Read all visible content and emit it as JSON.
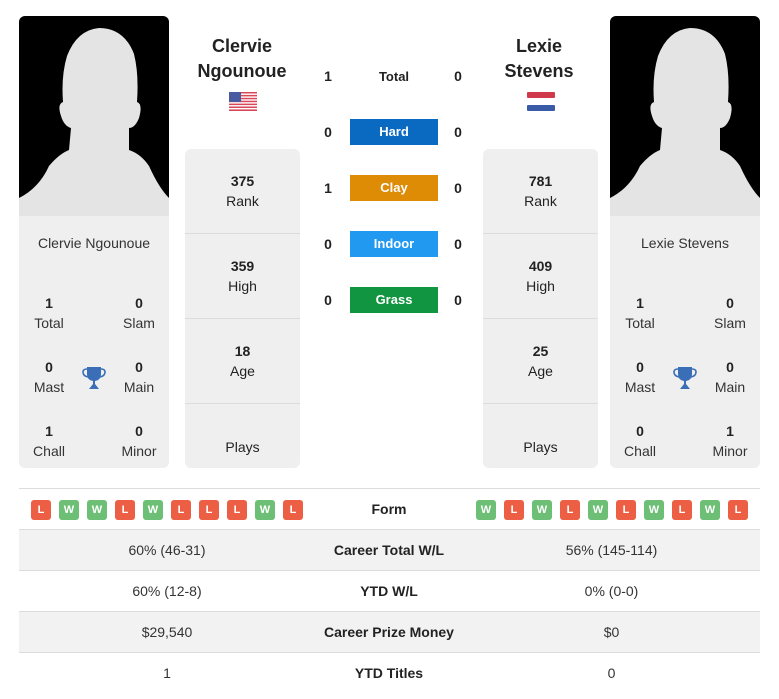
{
  "player_left": {
    "name_line1": "Clervie",
    "name_line2": "Ngounoue",
    "full_name": "Clervie Ngounoue",
    "flag": "us-flag-icon",
    "rank": "375",
    "rank_label": "Rank",
    "high": "359",
    "high_label": "High",
    "age": "18",
    "age_label": "Age",
    "plays_label": "Plays",
    "titles": {
      "total": "1",
      "total_label": "Total",
      "slam": "0",
      "slam_label": "Slam",
      "mast": "0",
      "mast_label": "Mast",
      "main": "0",
      "main_label": "Main",
      "chall": "1",
      "chall_label": "Chall",
      "minor": "0",
      "minor_label": "Minor"
    },
    "form": [
      "L",
      "W",
      "W",
      "L",
      "W",
      "L",
      "L",
      "L",
      "W",
      "L"
    ]
  },
  "player_right": {
    "name_line1": "Lexie",
    "name_line2": "Stevens",
    "full_name": "Lexie Stevens",
    "flag": "netherlands-flag-icon",
    "rank": "781",
    "rank_label": "Rank",
    "high": "409",
    "high_label": "High",
    "age": "25",
    "age_label": "Age",
    "plays_label": "Plays",
    "titles": {
      "total": "1",
      "total_label": "Total",
      "slam": "0",
      "slam_label": "Slam",
      "mast": "0",
      "mast_label": "Mast",
      "main": "0",
      "main_label": "Main",
      "chall": "0",
      "chall_label": "Chall",
      "minor": "1",
      "minor_label": "Minor"
    },
    "form": [
      "W",
      "L",
      "W",
      "L",
      "W",
      "L",
      "W",
      "L",
      "W",
      "L"
    ]
  },
  "h2h": {
    "total": {
      "label": "Total",
      "left": "1",
      "right": "0"
    },
    "surfaces": [
      {
        "label": "Hard",
        "left": "0",
        "right": "0",
        "color": "#0a6ac2"
      },
      {
        "label": "Clay",
        "left": "1",
        "right": "0",
        "color": "#de8b06"
      },
      {
        "label": "Indoor",
        "left": "0",
        "right": "0",
        "color": "#2299f1"
      },
      {
        "label": "Grass",
        "left": "0",
        "right": "0",
        "color": "#119540"
      }
    ]
  },
  "comparison": {
    "form_label": "Form",
    "rows": [
      {
        "label": "Career Total W/L",
        "left": "60% (46-31)",
        "right": "56% (145-114)"
      },
      {
        "label": "YTD W/L",
        "left": "60% (12-8)",
        "right": "0% (0-0)"
      },
      {
        "label": "Career Prize Money",
        "left": "$29,540",
        "right": "$0"
      },
      {
        "label": "YTD Titles",
        "left": "1",
        "right": "0"
      }
    ]
  },
  "colors": {
    "win": "#6cbf75",
    "loss": "#ec5f44",
    "trophy": "#3a6fb8"
  }
}
